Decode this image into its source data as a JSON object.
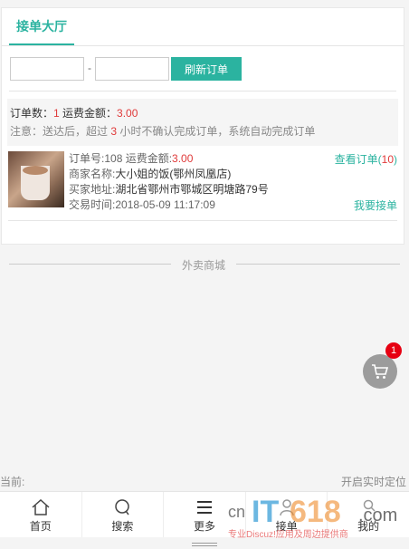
{
  "tab": {
    "label": "接单大厅"
  },
  "filter": {
    "start_value": "",
    "dash": "-",
    "end_value": "",
    "refresh_label": "刷新订单"
  },
  "summary": {
    "count_label": "订单数：",
    "count": "1",
    "fee_label": " 运费金额：",
    "fee": "3.00",
    "note_pre": "注意：送达后，超过 ",
    "note_hours": "3",
    "note_post": " 小时不确认完成订单，系统自动完成订单"
  },
  "order": {
    "number_label": "订单号:",
    "number": "108",
    "fee_label": " 运费金额:",
    "fee": "3.00",
    "shop_label": "商家名称:",
    "shop": "大小姐的饭(鄂州凤凰店)",
    "address_label": "买家地址:",
    "address": "湖北省鄂州市鄂城区明塘路79号",
    "time_label": "交易时间:",
    "time": "2018-05-09 11:17:09",
    "view_label": "查看订单(",
    "view_count": "10",
    "view_close": ")",
    "accept_label": "我要接单",
    "thumb_icon": "milk-tea-photo"
  },
  "section": {
    "label": "外卖商城"
  },
  "cart": {
    "icon": "cart-icon",
    "badge": "1",
    "bg": "#9c9c9c"
  },
  "location": {
    "current_label": "当前:",
    "locate_label": "开启实时定位"
  },
  "nav": [
    {
      "label": "首页",
      "icon": "home-icon"
    },
    {
      "label": "搜索",
      "icon": "search-icon"
    },
    {
      "label": "更多",
      "icon": "menu-icon"
    },
    {
      "label": "接单",
      "icon": "user-icon"
    },
    {
      "label": "我的",
      "icon": "profile-icon"
    }
  ],
  "watermark": {
    "brand_it": "IT",
    "brand_num": "618",
    "brand_cn": "cn",
    "brand_com": ".com",
    "tagline": "专业Discuz!应用及周边提供商"
  },
  "colors": {
    "accent": "#2bb3a0",
    "red": "#e03a3a",
    "badge": "#e60012"
  }
}
